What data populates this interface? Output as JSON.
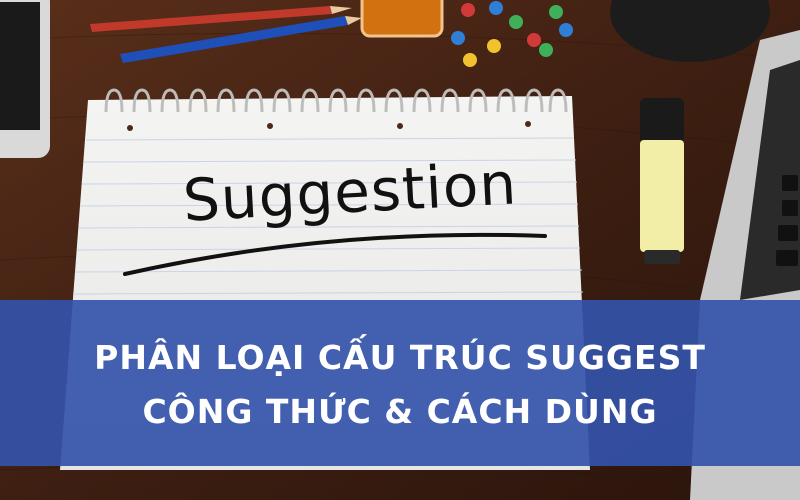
{
  "photo": {
    "notebook_word": "Suggestion",
    "objects": [
      "desk",
      "spiral-notebook",
      "red-pen",
      "blue-pen",
      "push-pins",
      "highlighter",
      "smartphone",
      "laptop",
      "mug"
    ]
  },
  "banner": {
    "line1": "PHÂN LOẠI CẤU TRÚC SUGGEST",
    "line2": "CÔNG THỨC & CÁCH DÙNG",
    "color": "#3452AA"
  }
}
